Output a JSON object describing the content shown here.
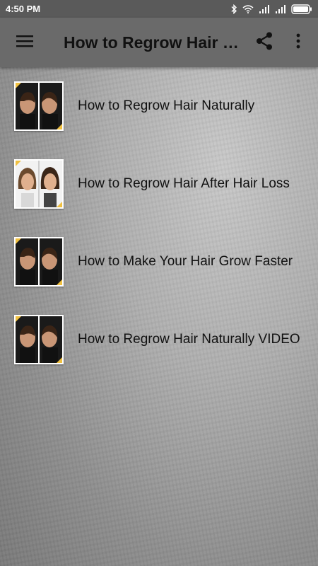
{
  "status_bar": {
    "time": "4:50 PM"
  },
  "app_bar": {
    "title": "How to Regrow Hair Naturally",
    "menu_icon": "hamburger-menu-icon",
    "share_icon": "share-icon",
    "more_icon": "more-vert-icon"
  },
  "list": {
    "items": [
      {
        "label": "How to Regrow Hair Naturally",
        "thumb": "before-after-hair-men"
      },
      {
        "label": "How to Regrow Hair After Hair Loss",
        "thumb": "before-after-hair-women"
      },
      {
        "label": "How to Make Your Hair Grow Faster",
        "thumb": "before-after-hair-men"
      },
      {
        "label": "How to Regrow Hair Naturally VIDEO",
        "thumb": "before-after-hair-men"
      }
    ]
  },
  "colors": {
    "status_bar_bg": "#5a5a5a",
    "app_bar_bg": "#6a6a6a",
    "text": "#111111"
  }
}
